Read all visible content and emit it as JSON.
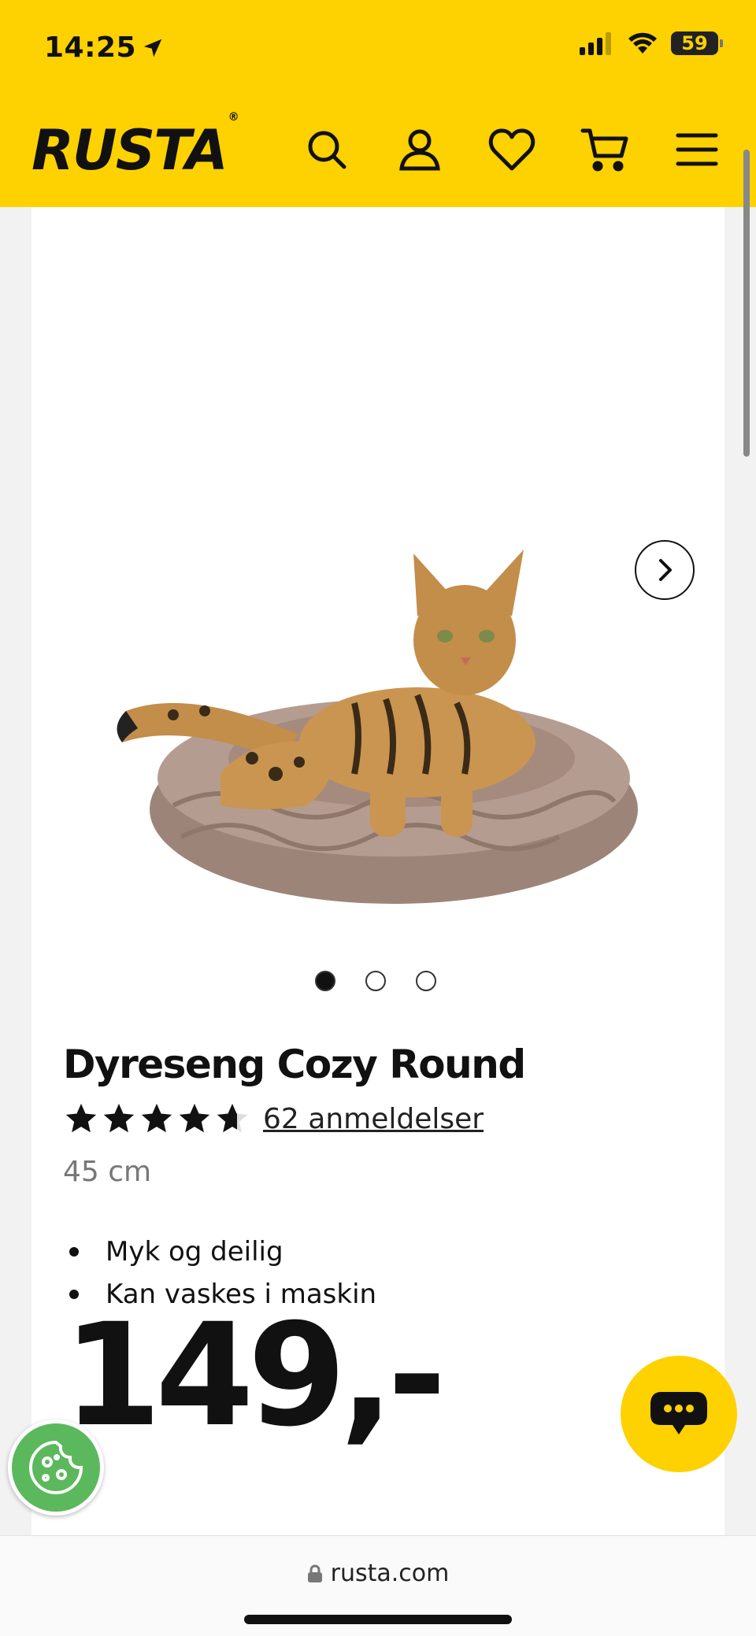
{
  "status_bar": {
    "time": "14:25",
    "battery": "59"
  },
  "header": {
    "logo": "RUSTA",
    "logo_mark": "®",
    "icons": [
      "search-icon",
      "account-icon",
      "heart-icon",
      "cart-icon",
      "menu-icon"
    ]
  },
  "product": {
    "title": "Dyreseng Cozy Round",
    "rating": 4.5,
    "reviews": "62 anmeldelser",
    "size": "45 cm",
    "features": [
      "Myk og deilig",
      "Kan vaskes i maskin"
    ],
    "price": "149,-",
    "carousel": {
      "count": 3,
      "active": 0
    }
  },
  "browser": {
    "url": "rusta.com"
  },
  "colors": {
    "brand_yellow": "#fed100",
    "cookie_green": "#5cb85c",
    "text": "#111111"
  }
}
